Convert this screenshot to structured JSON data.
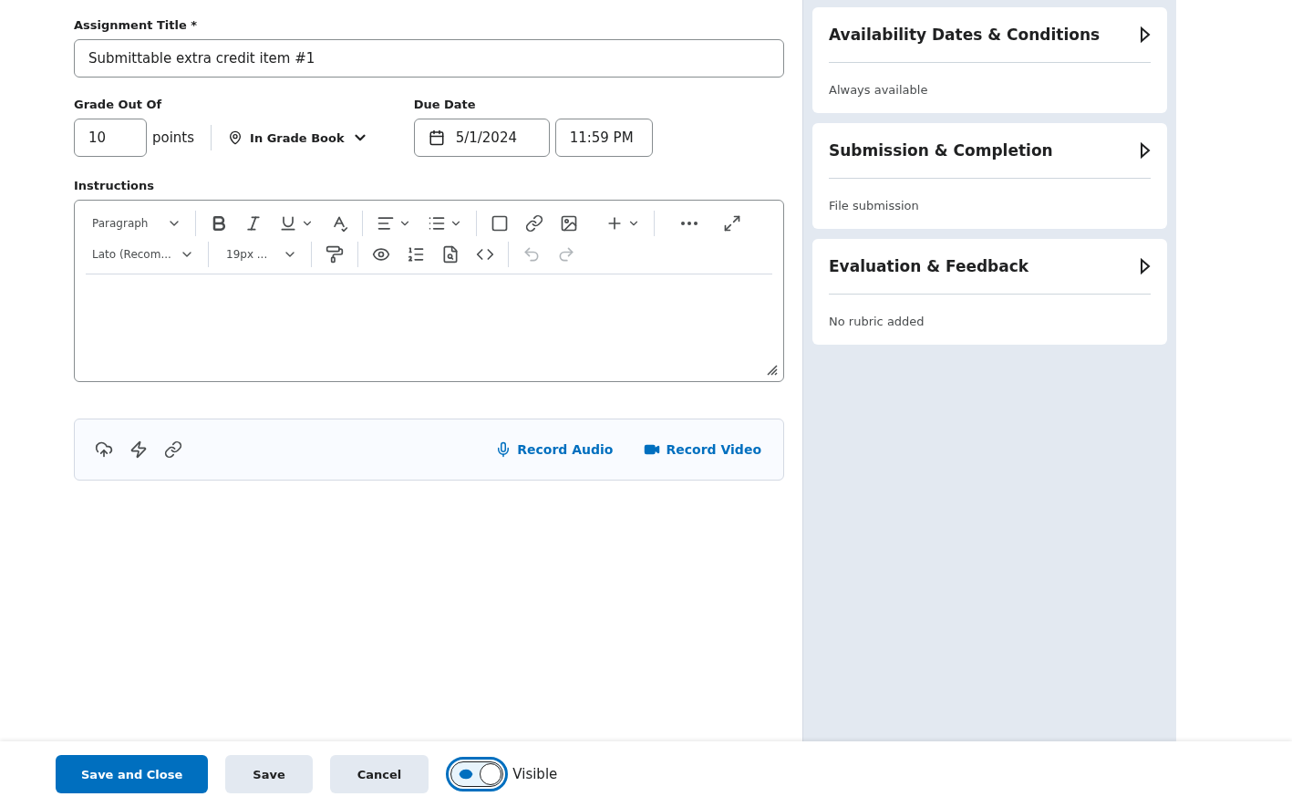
{
  "form": {
    "title_label": "Assignment Title *",
    "title_value": "Submittable extra credit item #1",
    "grade_label": "Grade Out Of",
    "grade_value": "10",
    "grade_unit": "points",
    "gradebook": "In Grade Book",
    "due_label": "Due Date",
    "due_date": "5/1/2024",
    "due_time": "11:59 PM",
    "instructions_label": "Instructions"
  },
  "editor": {
    "format": "Paragraph",
    "font": "Lato (Recom...",
    "size": "19px ...",
    "undo_disabled": true,
    "redo_disabled": true
  },
  "attachments": {
    "links": [
      "Record Audio",
      "Record Video"
    ]
  },
  "panels": [
    {
      "title": "Availability Dates & Conditions",
      "summary": "Always available",
      "expanded": false
    },
    {
      "title": "Submission & Completion",
      "summary": "File submission",
      "expanded": false
    },
    {
      "title": "Evaluation & Feedback",
      "summary": "No rubric added",
      "expanded": false
    }
  ],
  "footer": {
    "buttons": [
      {
        "label": "Save and Close",
        "primary": true
      },
      {
        "label": "Save",
        "primary": false
      },
      {
        "label": "Cancel",
        "primary": false
      }
    ],
    "visibility": {
      "label": "Visible",
      "on": true
    }
  }
}
